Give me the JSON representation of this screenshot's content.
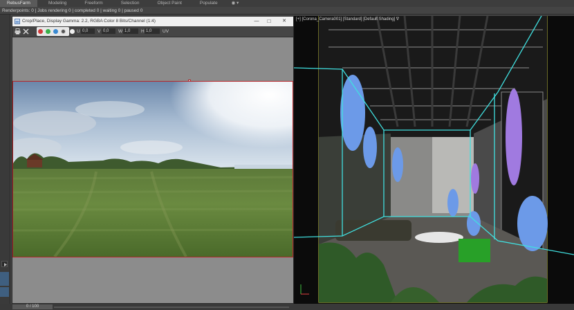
{
  "ribbon": {
    "tabs": [
      "RebusFarm",
      "Modeling",
      "Freeform",
      "Selection",
      "Object Paint",
      "Populate"
    ],
    "extra": "◉ ▾"
  },
  "status_line": "Renderpoints: 0 | Jobs rendering 0 | completed 0 | waiting 0 | paused 0",
  "frame_buffer": {
    "title": "Crop/Place, Display Gamma: 2.2, RGBA Color 8 Bits/Channel (1:4)",
    "controls": {
      "minimize": "—",
      "maximize": "□",
      "close": "✕"
    },
    "toolbar": {
      "u_label": "U",
      "u_value": "0,0",
      "v_label": "V",
      "v_value": "0,0",
      "w_label": "W",
      "w_value": "1,0",
      "h_label": "H",
      "h_value": "1,0",
      "uv_label": "UV"
    },
    "channel_colors": [
      "#d23a3a",
      "#3ab04a",
      "#3a8ad2",
      "#9a9a9a"
    ]
  },
  "viewport": {
    "label": "[+] [Corona_Camera001] [Standard] [Default Shading]  ∇"
  },
  "timeline": {
    "frame_counter": "0 / 100"
  },
  "icons": [
    "print-icon",
    "clear-icon",
    "window-icon",
    "play-icon"
  ]
}
